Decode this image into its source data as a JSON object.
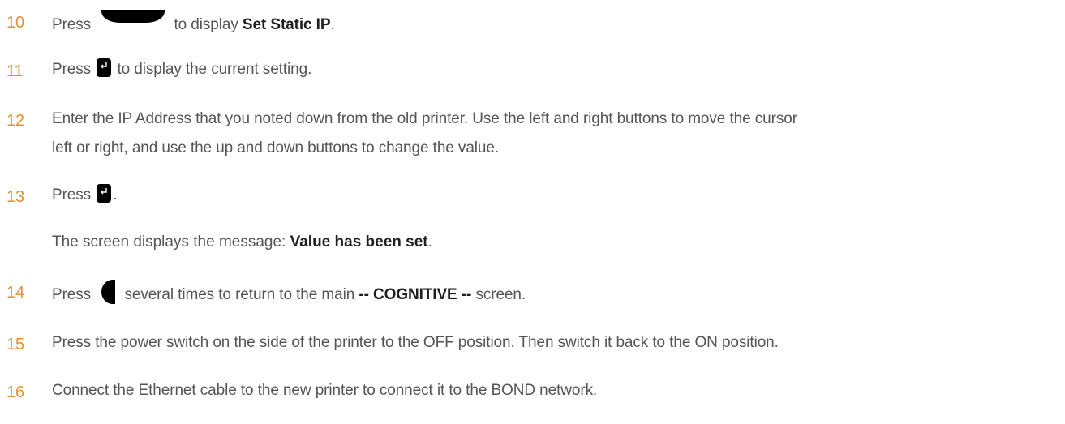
{
  "steps": [
    {
      "number": "10",
      "before_key": "Press",
      "key_icon": "down-arrow-key-icon",
      "after_key": "to display",
      "bold": "Set Static IP",
      "tail": "."
    },
    {
      "number": "11",
      "before_key": "Press",
      "key_icon": "enter-key-icon",
      "after_key": "to display the current setting."
    },
    {
      "number": "12",
      "line1": "Enter the IP Address that you noted down from the old printer. Use the left and right buttons to move the cursor",
      "line2": "left or right, and use the up and down buttons to change the value."
    },
    {
      "number": "13",
      "before_key": "Press",
      "key_icon": "enter-key-icon",
      "after_key": "."
    },
    {
      "number": "14",
      "before_key": "Press",
      "key_icon": "left-arrow-key-icon",
      "after_key": "several times to return to the main",
      "bold": "-- COGNITIVE --",
      "tail": "screen."
    },
    {
      "number": "15",
      "text": "Press the power switch on the side of the printer to the OFF position. Then switch it back to the ON position."
    },
    {
      "number": "16",
      "text": "Connect the Ethernet cable to the new printer to connect it to the BOND network."
    }
  ],
  "note13": {
    "prefix": "The screen displays the message:",
    "bold": "Value has been set",
    "suffix": "."
  },
  "colors": {
    "step_number": "#e6902f",
    "body_text": "#555555",
    "bold_text": "#1f1f1f",
    "key_fill": "#000000"
  }
}
